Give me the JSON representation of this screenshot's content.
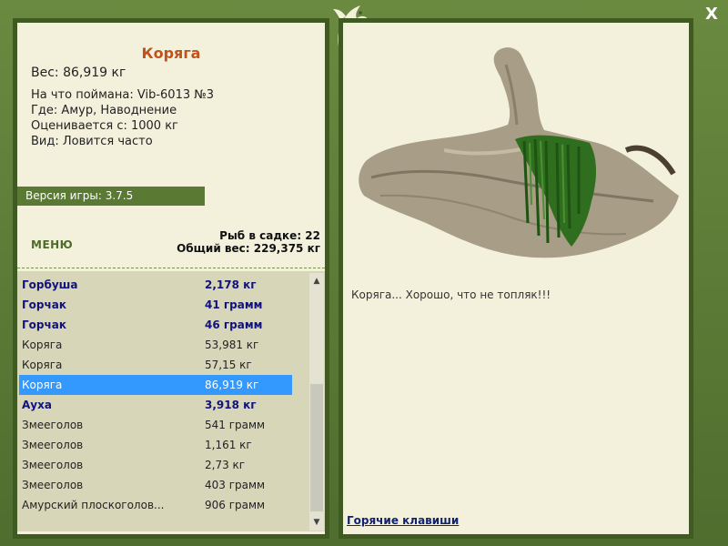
{
  "window": {
    "close_label": "X"
  },
  "fish": {
    "title": "Коряга",
    "weight": "Вес: 86,919 кг",
    "bait": "На что поймана: Vib-6013 №3",
    "place": "Где: Амур, Наводнение",
    "value": "Оценивается с: 1000 кг",
    "rarity": "Вид: Ловится часто"
  },
  "version": "Версия игры: 3.7.5",
  "menu_label": "МЕНЮ",
  "stats": {
    "count": "Рыб в садке: 22",
    "total": "Общий вес: 229,375 кг"
  },
  "catch_list": [
    {
      "name": "Горбуша",
      "weight": "2,178 кг"
    },
    {
      "name": "Горчак",
      "weight": "41 грамм"
    },
    {
      "name": "Горчак",
      "weight": "46 грамм"
    },
    {
      "name": "Коряга",
      "weight": "53,981 кг"
    },
    {
      "name": "Коряга",
      "weight": "57,15 кг"
    },
    {
      "name": "Коряга",
      "weight": "86,919 кг"
    },
    {
      "name": "Ауха",
      "weight": "3,918 кг"
    },
    {
      "name": "Змееголов",
      "weight": "541 грамм"
    },
    {
      "name": "Змееголов",
      "weight": "1,161 кг"
    },
    {
      "name": "Змееголов",
      "weight": "2,73 кг"
    },
    {
      "name": "Змееголов",
      "weight": "403 грамм"
    },
    {
      "name": "Амурский плоскоголов...",
      "weight": "906 грамм"
    }
  ],
  "caption": "Коряга... Хорошо, что не топляк!!!",
  "hotkeys_label": "Горячие клавиши",
  "colors": {
    "accent": "#5a7a34",
    "selected": "#3399ff",
    "title": "#c2521a",
    "highlight_text": "#12137a"
  }
}
